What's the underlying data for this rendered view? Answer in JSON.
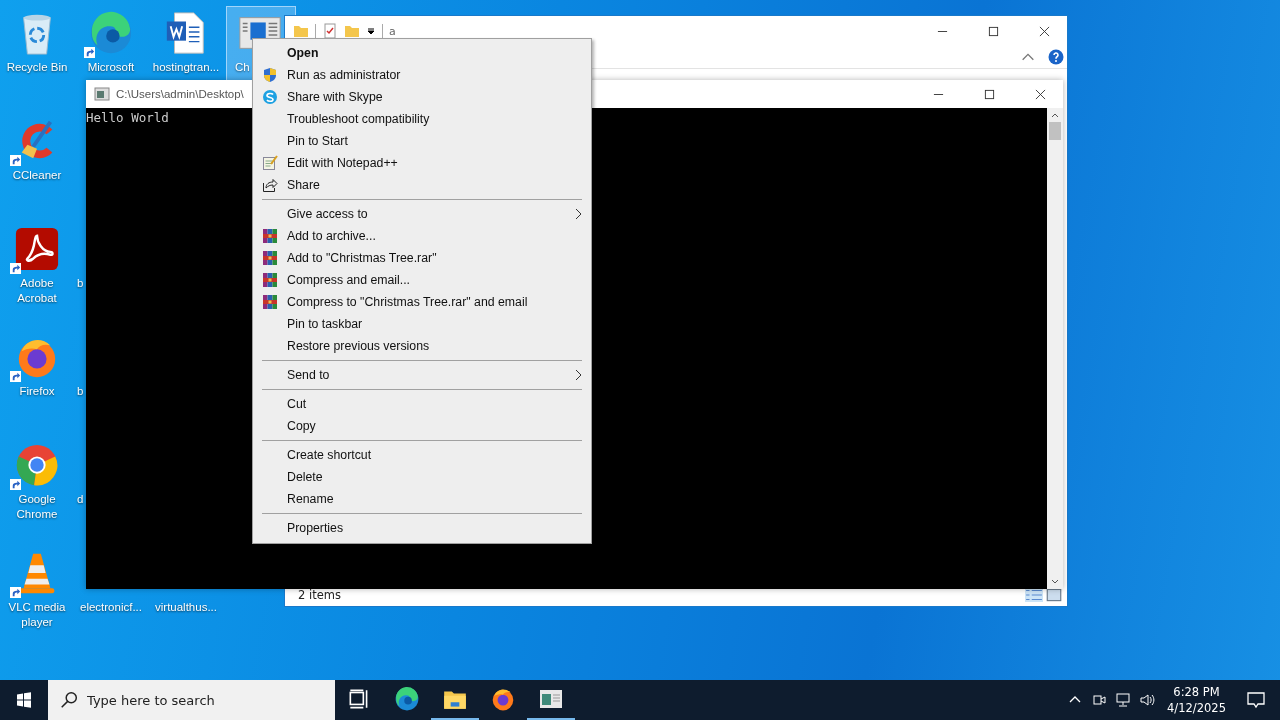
{
  "desktop_icons": [
    {
      "label": "Recycle Bin",
      "kind": "recycle",
      "selected": false
    },
    {
      "label": "CCleaner",
      "kind": "ccleaner",
      "shortcut": true,
      "selected": false
    },
    {
      "label": "Adobe Acrobat",
      "kind": "acrobat",
      "shortcut": true,
      "selected": false
    },
    {
      "label": "Firefox",
      "kind": "firefox",
      "shortcut": true,
      "selected": false
    },
    {
      "label": "Google Chrome",
      "kind": "chrome",
      "shortcut": true,
      "selected": false
    },
    {
      "label": "VLC media player",
      "kind": "vlc",
      "shortcut": true,
      "selected": false
    },
    {
      "label": "Microsoft",
      "kind": "edge",
      "shortcut": true,
      "selected": false
    },
    {
      "label": "b",
      "kind": "hidden",
      "selected": false
    },
    {
      "label": "b",
      "kind": "hidden",
      "selected": false
    },
    {
      "label": "d",
      "kind": "hidden",
      "selected": false
    },
    {
      "label": "electronicf...",
      "kind": "hidden",
      "selected": false
    },
    {
      "label": "hostingtran...",
      "kind": "word",
      "selected": false
    },
    {
      "label": "virtualthus...",
      "kind": "hidden",
      "selected": false
    },
    {
      "label": "Ch",
      "kind": "console",
      "selected": true
    }
  ],
  "explorer": {
    "title": "a",
    "status": "2 items"
  },
  "console": {
    "title": "C:\\Users\\admin\\Desktop\\",
    "output": "Hello World"
  },
  "context_menu": [
    {
      "kind": "default",
      "label": "Open"
    },
    {
      "kind": "shield",
      "label": "Run as administrator"
    },
    {
      "kind": "skype",
      "label": "Share with Skype"
    },
    {
      "kind": "plain",
      "label": "Troubleshoot compatibility"
    },
    {
      "kind": "plain",
      "label": "Pin to Start"
    },
    {
      "kind": "notepad",
      "label": "Edit with Notepad++"
    },
    {
      "kind": "share",
      "label": "Share"
    },
    {
      "kind": "separator"
    },
    {
      "kind": "submenu",
      "label": "Give access to"
    },
    {
      "kind": "archive",
      "label": "Add to archive..."
    },
    {
      "kind": "archive",
      "label": "Add to \"Christmas Tree.rar\""
    },
    {
      "kind": "archive",
      "label": "Compress and email..."
    },
    {
      "kind": "archive",
      "label": "Compress to \"Christmas Tree.rar\" and email"
    },
    {
      "kind": "plain",
      "label": "Pin to taskbar"
    },
    {
      "kind": "plain",
      "label": "Restore previous versions"
    },
    {
      "kind": "separator"
    },
    {
      "kind": "submenu",
      "label": "Send to"
    },
    {
      "kind": "separator"
    },
    {
      "kind": "plain",
      "label": "Cut"
    },
    {
      "kind": "plain",
      "label": "Copy"
    },
    {
      "kind": "separator"
    },
    {
      "kind": "plain",
      "label": "Create shortcut"
    },
    {
      "kind": "plain",
      "label": "Delete"
    },
    {
      "kind": "plain",
      "label": "Rename"
    },
    {
      "kind": "separator"
    },
    {
      "kind": "plain",
      "label": "Properties"
    }
  ],
  "taskbar": {
    "search": {
      "placeholder": "Type here to search"
    },
    "apps": [
      {
        "kind": "taskview",
        "running": false
      },
      {
        "kind": "edge",
        "running": false
      },
      {
        "kind": "explorer",
        "running": true
      },
      {
        "kind": "firefox",
        "running": false
      },
      {
        "kind": "console",
        "running": true
      }
    ],
    "time": "6:28 PM",
    "date": "4/12/2025"
  }
}
